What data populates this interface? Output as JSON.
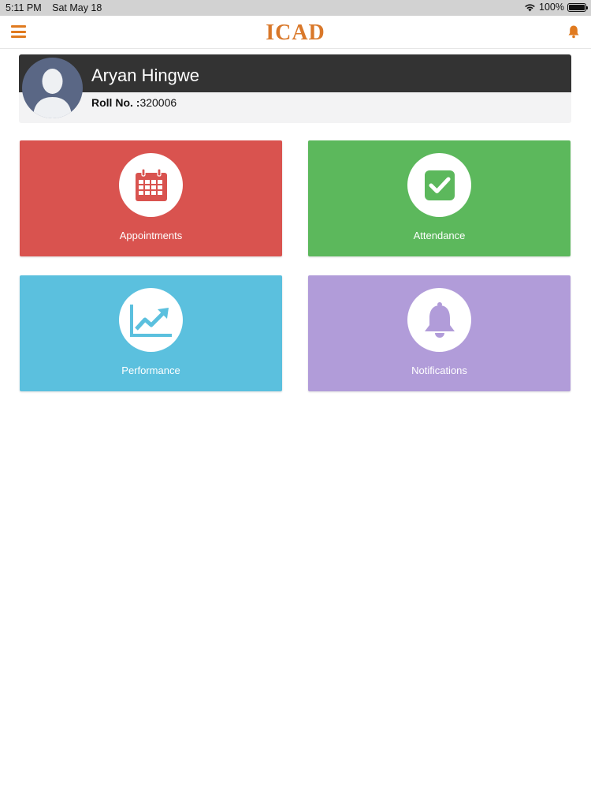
{
  "status_bar": {
    "time": "5:11 PM",
    "date": "Sat May 18",
    "battery": "100%",
    "battery_level": 1.0
  },
  "nav": {
    "brand": "ICAD",
    "accent_color": "#e07a1f"
  },
  "profile": {
    "name": "Aryan Hingwe",
    "roll_label": "Roll No. :",
    "roll_number": "320006"
  },
  "tiles": [
    {
      "label": "Appointments",
      "icon": "calendar-icon",
      "color": "#d9534f"
    },
    {
      "label": "Attendance",
      "icon": "checkbox-icon",
      "color": "#5cb85c"
    },
    {
      "label": "Performance",
      "icon": "trend-chart-icon",
      "color": "#5bc0de"
    },
    {
      "label": "Notifications",
      "icon": "bell-icon",
      "color": "#b19cd9"
    }
  ]
}
